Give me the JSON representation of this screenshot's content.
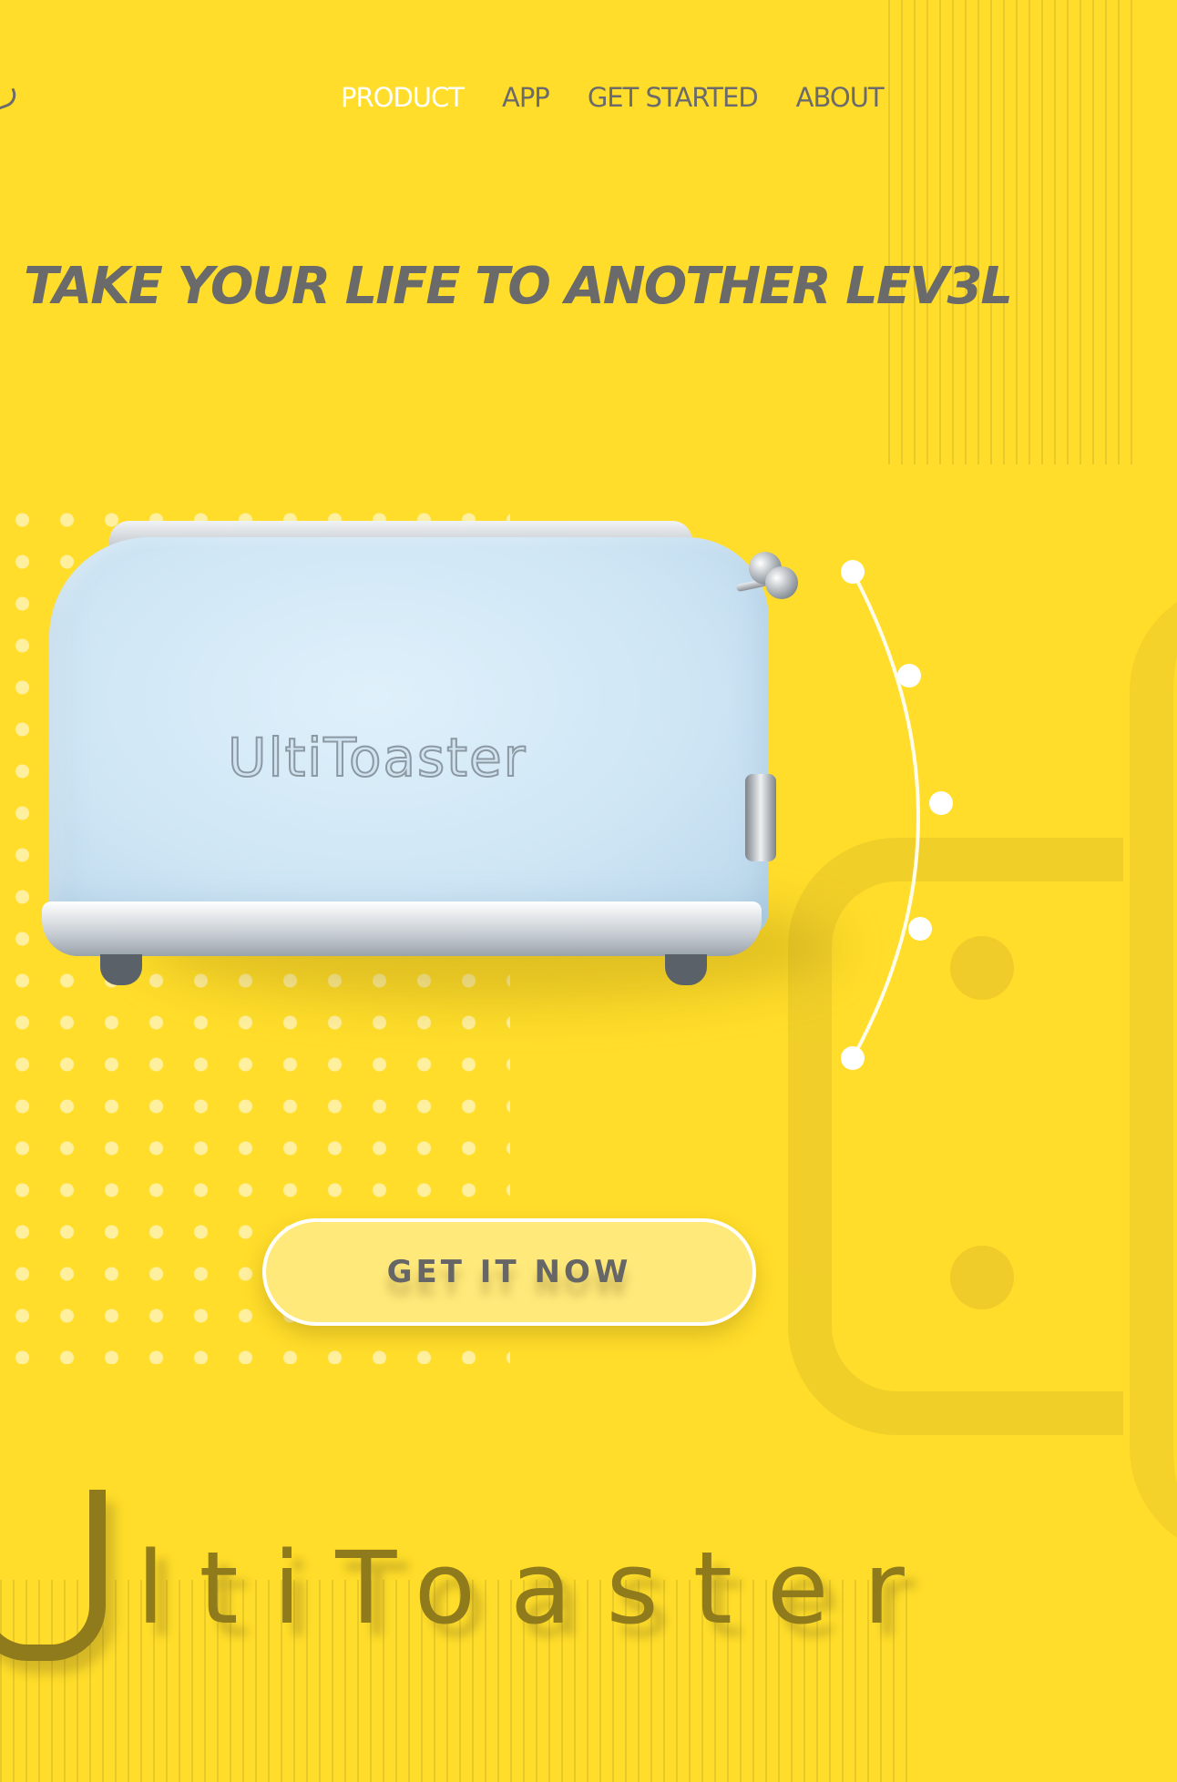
{
  "nav": {
    "items": [
      {
        "label": "PRODUCT",
        "active": true
      },
      {
        "label": "APP",
        "active": false
      },
      {
        "label": "GET STARTED",
        "active": false
      },
      {
        "label": "ABOUT",
        "active": false
      }
    ]
  },
  "hero": {
    "headline": "TAKE YOUR LIFE TO ANOTHER LEV3L",
    "product_brand": "UltiToaster",
    "cta_label": "GET IT NOW"
  },
  "wordmark": {
    "first_letter": "U",
    "rest": "ltiToaster"
  },
  "colors": {
    "background": "#FFDD2A",
    "nav_active": "#FFFFFF",
    "nav_inactive": "#6B6B6B",
    "headline": "#6A6A6A",
    "cta_fill": "#FFE97A",
    "wordmark": "#8F7A1C",
    "toaster_body": "#CFE6F5"
  },
  "icons": {
    "logo": "logo-mark-icon",
    "arc_selector": "arc-dots-icon"
  }
}
